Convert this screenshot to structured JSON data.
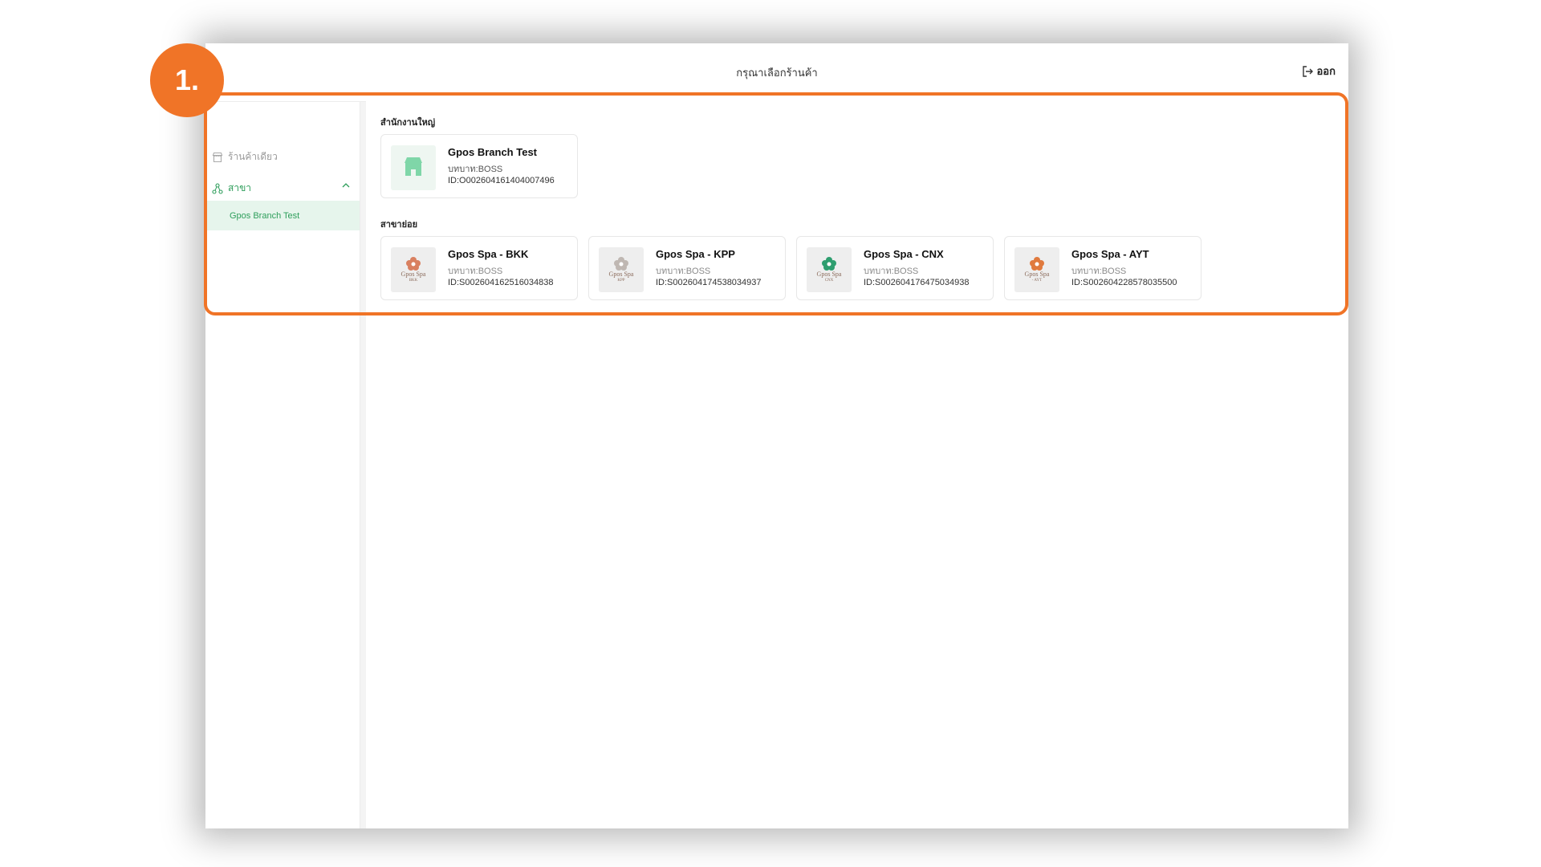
{
  "header": {
    "title": "กรุณาเลือกร้านค้า",
    "logout_label": "ออก"
  },
  "sidebar": {
    "single_store_label": "ร้านค้าเดียว",
    "branch_label": "สาขา",
    "selected_branch": "Gpos Branch Test"
  },
  "main": {
    "hq_section_label": "สำนักงานใหญ่",
    "hq_card": {
      "name": "Gpos Branch Test",
      "role": "บทบาท:BOSS",
      "id": "ID:O002604161404007496"
    },
    "branch_section_label": "สาขาย่อย",
    "branches": [
      {
        "name": "Gpos Spa - BKK",
        "role": "บทบาท:BOSS",
        "id": "ID:S002604162516034838",
        "logo_text": "Gpos Spa",
        "logo_sub": "BKK",
        "logo_color": "#d98060"
      },
      {
        "name": "Gpos Spa - KPP",
        "role": "บทบาท:BOSS",
        "id": "ID:S002604174538034937",
        "logo_text": "Gpos Spa",
        "logo_sub": "KPP",
        "logo_color": "#b8b0ab"
      },
      {
        "name": "Gpos Spa - CNX",
        "role": "บทบาท:BOSS",
        "id": "ID:S002604176475034938",
        "logo_text": "Gpos Spa",
        "logo_sub": "CNX",
        "logo_color": "#2e9e6f"
      },
      {
        "name": "Gpos Spa - AYT",
        "role": "บทบาท:BOSS",
        "id": "ID:S002604228578035500",
        "logo_text": "Gpos Spa",
        "logo_sub": "- AYT",
        "logo_color": "#e07a3e"
      }
    ]
  },
  "annotation": {
    "step_label": "1.",
    "accent_color": "#f07427"
  },
  "colors": {
    "brand_green": "#2e9e5b",
    "selected_bg": "#e6f5ec"
  }
}
